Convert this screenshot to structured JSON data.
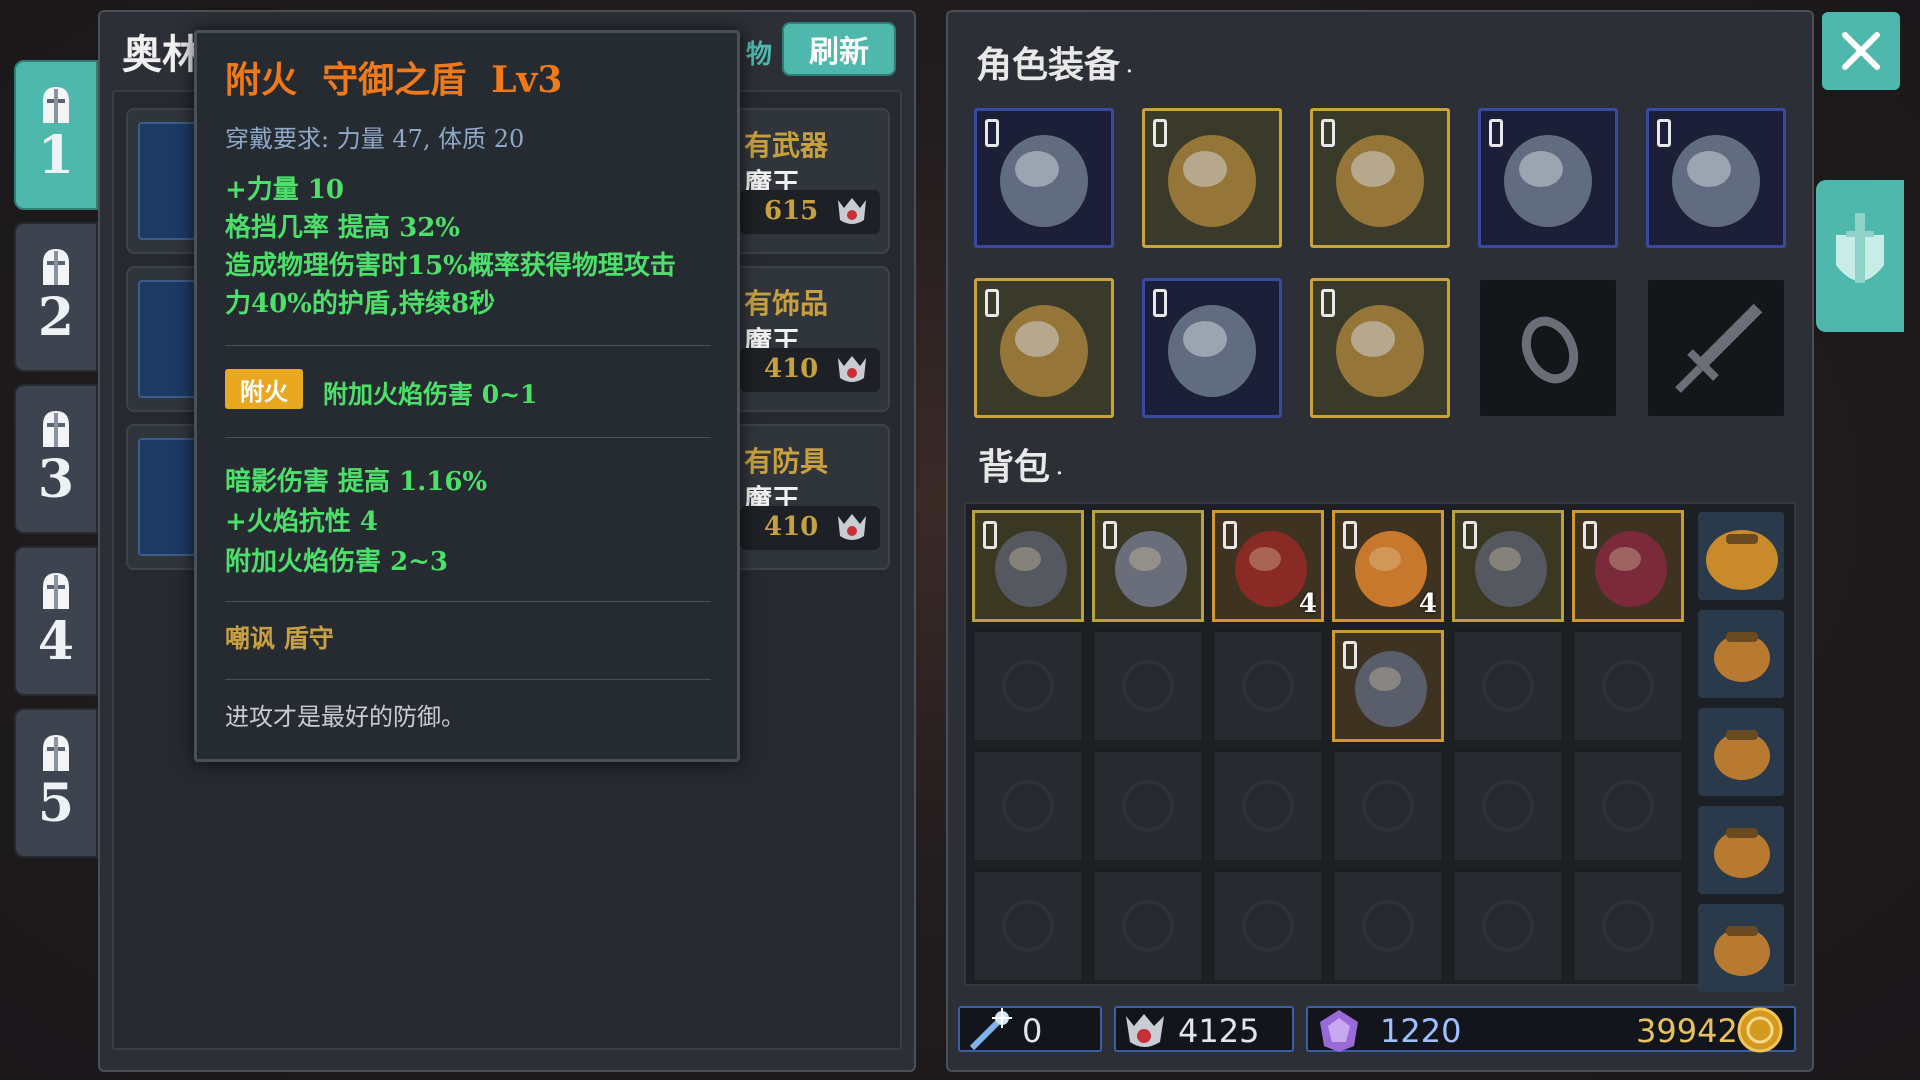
{
  "tabs": [
    {
      "label": "1",
      "active": true
    },
    {
      "label": "2",
      "active": false
    },
    {
      "label": "3",
      "active": false
    },
    {
      "label": "4",
      "active": false
    },
    {
      "label": "5",
      "active": false
    }
  ],
  "shop": {
    "title_partial": "奥林",
    "filter_partial": "物",
    "refresh_label": "刷新",
    "rows": [
      {
        "category": "有武器",
        "vendor": "魔王",
        "price": "615"
      },
      {
        "category": "有饰品",
        "vendor": "魔王",
        "price": "410"
      },
      {
        "category": "有防具",
        "vendor": "魔王",
        "price": "410"
      }
    ]
  },
  "tooltip": {
    "enchant": "附火",
    "item_name": "守御之盾",
    "level": "Lv3",
    "requirement": "穿戴要求:   力量 47, 体质 20",
    "stats": [
      "+力量 10",
      "格挡几率  提高  32%",
      "造成物理伤害时15%概率获得物理攻击",
      "力40%的护盾,持续8秒"
    ],
    "enchant_badge": "附火",
    "enchant_effect": "附加火焰伤害  0~1",
    "extra_stats": [
      "暗影伤害  提高  1.16%",
      "+火焰抗性  4",
      "附加火焰伤害  2~3"
    ],
    "tags": "嘲讽   盾守",
    "flavor": "进攻才是最好的防御。"
  },
  "equipment": {
    "title": "角色装备",
    "slots": [
      {
        "icon": "helmet-icon",
        "quality": "blue",
        "locked": true
      },
      {
        "icon": "chest-armor-icon",
        "quality": "gold",
        "locked": true
      },
      {
        "icon": "shoulder-armor-icon",
        "quality": "gold",
        "locked": true
      },
      {
        "icon": "bracelet-icon",
        "quality": "blue",
        "locked": true
      },
      {
        "icon": "bow-icon",
        "quality": "blue",
        "locked": true
      },
      {
        "icon": "amulet-icon",
        "quality": "gold",
        "locked": true
      },
      {
        "icon": "gauntlet-icon",
        "quality": "blue",
        "locked": true
      },
      {
        "icon": "boots-icon",
        "quality": "gold",
        "locked": true
      },
      {
        "icon": "ring-icon",
        "quality": "empty",
        "locked": false
      },
      {
        "icon": "sword-icon",
        "quality": "empty",
        "locked": false
      }
    ]
  },
  "bag": {
    "title": "背包",
    "items": [
      {
        "icon": "dagger-icon",
        "quality": "ygold",
        "count": ""
      },
      {
        "icon": "battle-axe-icon",
        "quality": "ygold",
        "count": ""
      },
      {
        "icon": "rune-disc-icon",
        "quality": "gold",
        "count": "4"
      },
      {
        "icon": "scroll-icon",
        "quality": "gold",
        "count": "4"
      },
      {
        "icon": "greatsword-icon",
        "quality": "ygold",
        "count": ""
      },
      {
        "icon": "staff-icon",
        "quality": "gold",
        "count": ""
      },
      {
        "icon": "shield-icon",
        "quality": "gold",
        "count": ""
      }
    ],
    "side_bags": [
      "large-bag-icon",
      "backpack-icon",
      "pouch-icon",
      "pouch-icon",
      "pouch-icon"
    ]
  },
  "currency": {
    "scrolls": "0",
    "souls": "4125",
    "crystals": "1220",
    "gold": "39942"
  },
  "colors": {
    "accent": "#4fb8ac",
    "title_orange": "#f07a1a",
    "stat_green": "#4ce06a",
    "requirement_blue": "#8fa8c8",
    "gold_text": "#c8a040"
  }
}
